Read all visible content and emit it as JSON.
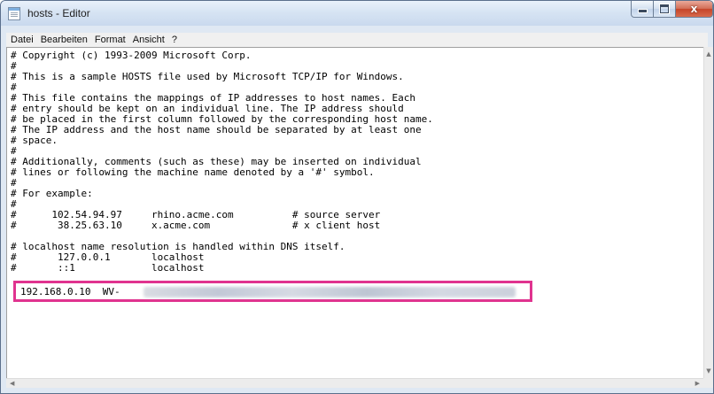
{
  "window": {
    "title": "hosts - Editor",
    "controls": {
      "minimize": "",
      "maximize": "",
      "close": "x"
    }
  },
  "menu": [
    "Datei",
    "Bearbeiten",
    "Format",
    "Ansicht",
    "?"
  ],
  "editor": {
    "lines": [
      "# Copyright (c) 1993-2009 Microsoft Corp.",
      "#",
      "# This is a sample HOSTS file used by Microsoft TCP/IP for Windows.",
      "#",
      "# This file contains the mappings of IP addresses to host names. Each",
      "# entry should be kept on an individual line. The IP address should",
      "# be placed in the first column followed by the corresponding host name.",
      "# The IP address and the host name should be separated by at least one",
      "# space.",
      "#",
      "# Additionally, comments (such as these) may be inserted on individual",
      "# lines or following the machine name denoted by a '#' symbol.",
      "#",
      "# For example:",
      "#",
      "#      102.54.94.97     rhino.acme.com          # source server",
      "#       38.25.63.10     x.acme.com              # x client host",
      "",
      "# localhost name resolution is handled within DNS itself.",
      "#       127.0.0.1       localhost",
      "#       ::1             localhost"
    ],
    "highlighted_line": "192.168.0.10  WV-"
  },
  "colors": {
    "highlight_border": "#e0338f",
    "title_bar": "#d7e4f3",
    "close_button": "#c5452a"
  }
}
